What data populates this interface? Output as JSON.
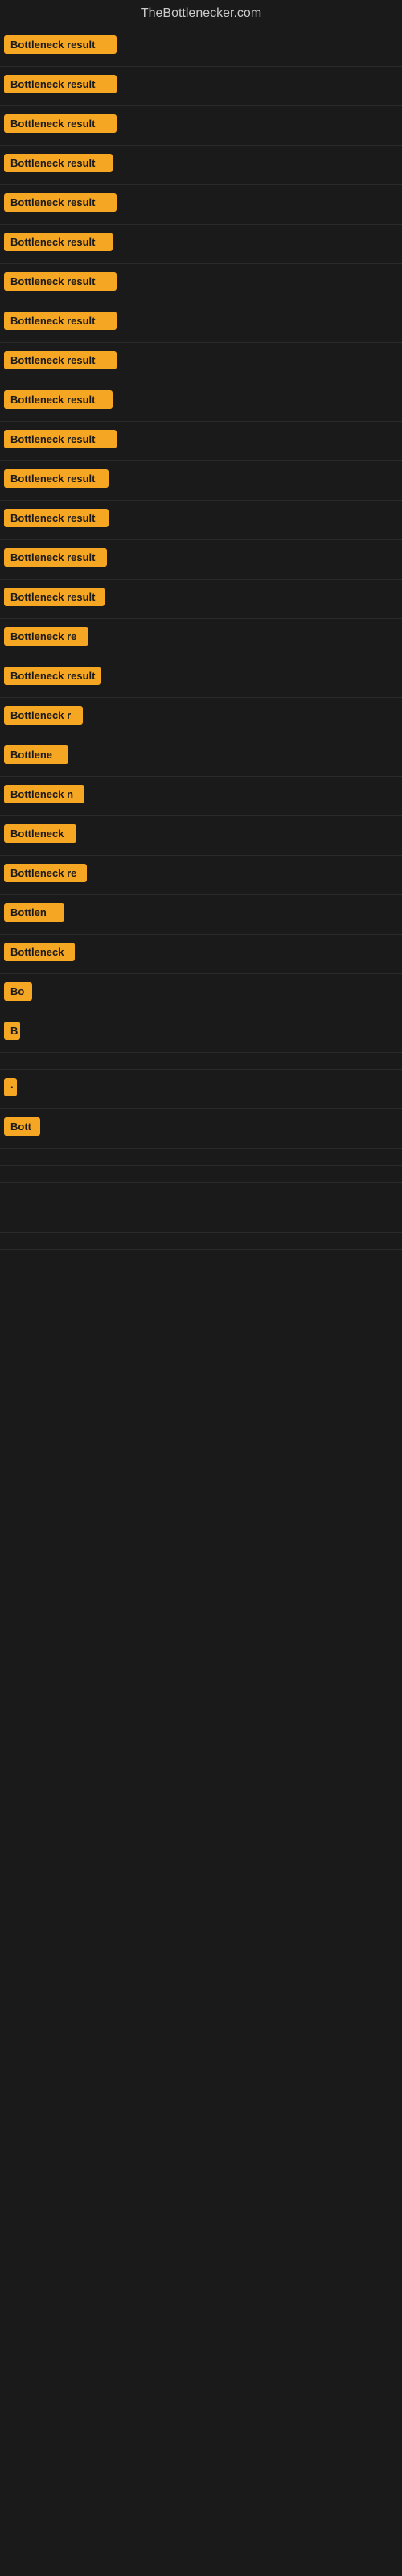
{
  "site": {
    "title": "TheBottlenecker.com"
  },
  "rows": [
    {
      "label": "Bottleneck result",
      "width": 140
    },
    {
      "label": "Bottleneck result",
      "width": 140
    },
    {
      "label": "Bottleneck result",
      "width": 140
    },
    {
      "label": "Bottleneck result",
      "width": 135
    },
    {
      "label": "Bottleneck result",
      "width": 140
    },
    {
      "label": "Bottleneck result",
      "width": 135
    },
    {
      "label": "Bottleneck result",
      "width": 140
    },
    {
      "label": "Bottleneck result",
      "width": 140
    },
    {
      "label": "Bottleneck result",
      "width": 140
    },
    {
      "label": "Bottleneck result",
      "width": 135
    },
    {
      "label": "Bottleneck result",
      "width": 140
    },
    {
      "label": "Bottleneck result",
      "width": 130
    },
    {
      "label": "Bottleneck result",
      "width": 130
    },
    {
      "label": "Bottleneck result",
      "width": 128
    },
    {
      "label": "Bottleneck result",
      "width": 125
    },
    {
      "label": "Bottleneck re",
      "width": 105
    },
    {
      "label": "Bottleneck result",
      "width": 120
    },
    {
      "label": "Bottleneck r",
      "width": 98
    },
    {
      "label": "Bottlene",
      "width": 80
    },
    {
      "label": "Bottleneck n",
      "width": 100
    },
    {
      "label": "Bottleneck",
      "width": 90
    },
    {
      "label": "Bottleneck re",
      "width": 103
    },
    {
      "label": "Bottlen",
      "width": 75
    },
    {
      "label": "Bottleneck",
      "width": 88
    },
    {
      "label": "Bo",
      "width": 35
    },
    {
      "label": "B",
      "width": 20
    },
    {
      "label": "",
      "width": 0
    },
    {
      "label": "·",
      "width": 12
    },
    {
      "label": "Bott",
      "width": 45
    },
    {
      "label": "",
      "width": 0
    },
    {
      "label": "",
      "width": 0
    },
    {
      "label": "",
      "width": 0
    },
    {
      "label": "",
      "width": 0
    },
    {
      "label": "",
      "width": 0
    },
    {
      "label": "",
      "width": 0
    }
  ]
}
